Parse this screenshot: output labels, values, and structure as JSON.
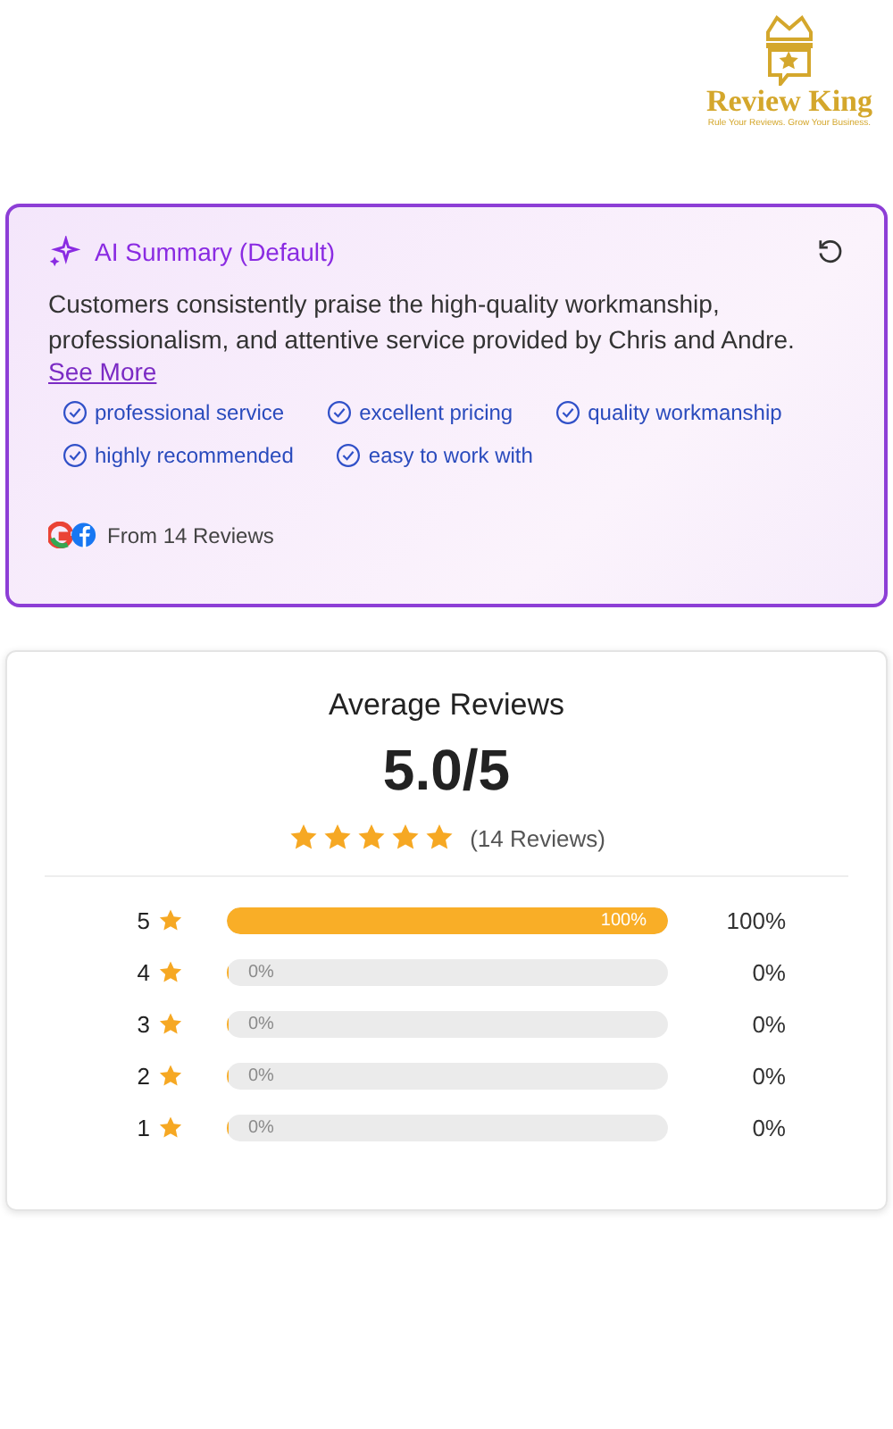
{
  "logo": {
    "name": "Review King",
    "tagline": "Rule Your Reviews. Grow Your Business."
  },
  "summary": {
    "title": "AI Summary (Default)",
    "text": "Customers consistently praise the high-quality workmanship, professionalism, and attentive service provided by Chris and Andre.",
    "link": "See More",
    "tags": [
      {
        "label": "professional service"
      },
      {
        "label": "excellent pricing"
      },
      {
        "label": "quality workmanship"
      },
      {
        "label": "highly recommended"
      },
      {
        "label": "easy to work with"
      }
    ],
    "source": "From 14 Reviews"
  },
  "average": {
    "title": "Average Reviews",
    "score": "5.0/5",
    "stars": 5,
    "count": "(14 Reviews)",
    "rows": [
      {
        "rating": "5",
        "level": 1,
        "bar_label": "100%",
        "percent": "100%"
      },
      {
        "rating": "4",
        "level": 0,
        "bar_label": "0%",
        "percent": "0%"
      },
      {
        "rating": "3",
        "level": 0,
        "bar_label": "0%",
        "percent": "0%"
      },
      {
        "rating": "2",
        "level": 0,
        "bar_label": "0%",
        "percent": "0%"
      },
      {
        "rating": "1",
        "level": 0,
        "bar_label": "0%",
        "percent": "0%"
      }
    ]
  }
}
